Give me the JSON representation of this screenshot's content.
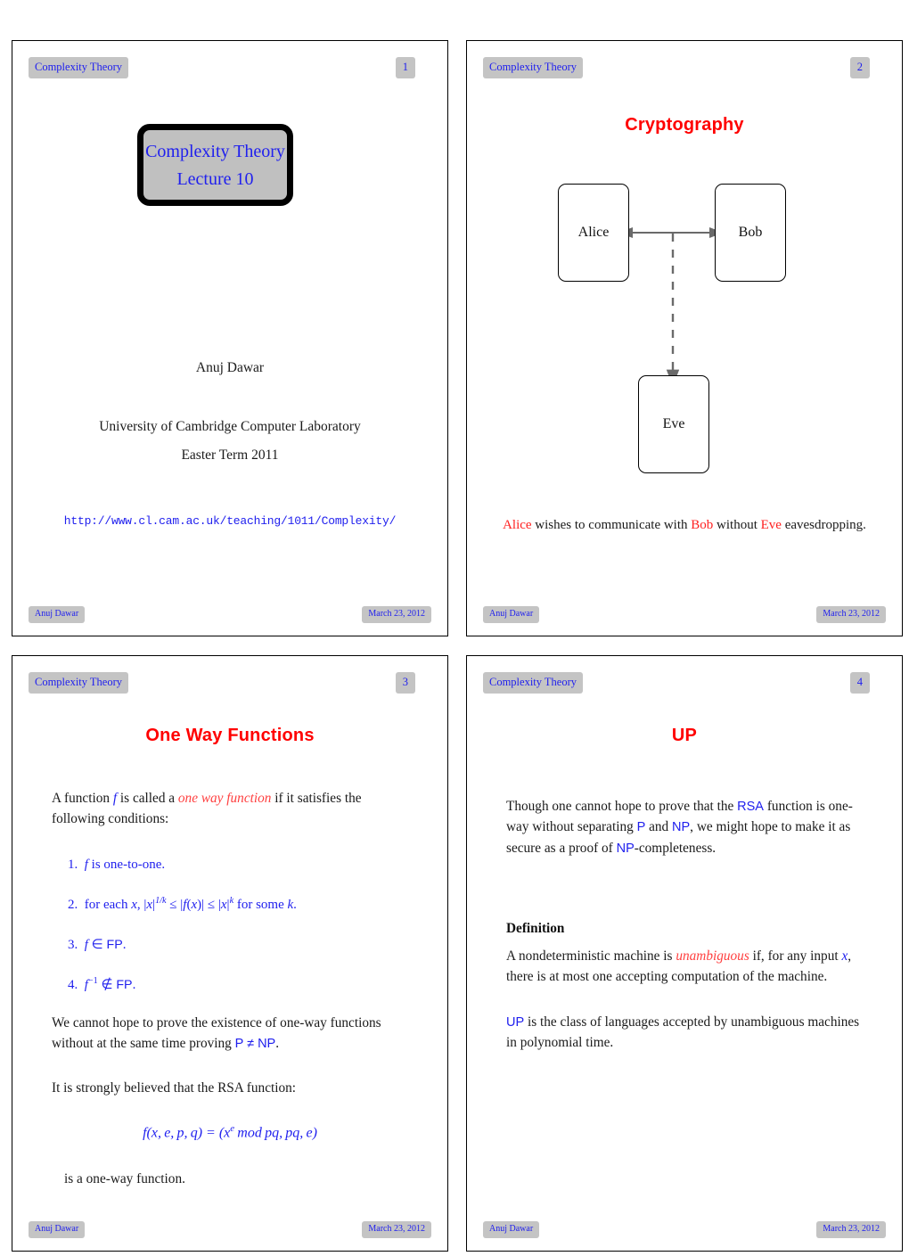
{
  "document": {
    "header_title": "Complexity Theory",
    "footer_author": "Anuj Dawar",
    "footer_date": "March 23, 2012"
  },
  "colors": {
    "heading_red": "#ff0000",
    "link_blue": "#2020ee",
    "badge_gray": "#c4c4c4",
    "title_box_fill": "#c0c0c0",
    "arrow_gray": "#666666"
  },
  "slides": [
    {
      "page": "1",
      "header": "Complexity Theory",
      "title_box": {
        "line1": "Complexity Theory",
        "line2": "Lecture 10"
      },
      "author": "Anuj Dawar",
      "institution": "University of Cambridge Computer Laboratory",
      "term": "Easter Term 2011",
      "url": "http://www.cl.cam.ac.uk/teaching/1011/Complexity/",
      "footer_author": "Anuj Dawar",
      "footer_date": "March 23, 2012"
    },
    {
      "page": "2",
      "header": "Complexity Theory",
      "heading": "Cryptography",
      "nodes": [
        {
          "label": "Alice"
        },
        {
          "label": "Bob"
        },
        {
          "label": "Eve"
        }
      ],
      "caption": {
        "part1": "Alice",
        "part2": " wishes to communicate with ",
        "part3": "Bob",
        "part4": " without ",
        "part5": "Eve",
        "part6": " eavesdropping."
      },
      "footer_author": "Anuj Dawar",
      "footer_date": "March 23, 2012"
    },
    {
      "page": "3",
      "header": "Complexity Theory",
      "heading": "One Way Functions",
      "intro": {
        "a": "A function ",
        "f": "f",
        "b": " is called a ",
        "term": "one way function",
        "c": " if it satisfies the following conditions:"
      },
      "conditions": [
        {
          "num": "1.",
          "text_html": "f is one-to-one."
        },
        {
          "num": "2.",
          "text_html": "for each x, |x|^(1/k) <= |f(x)| <= |x|^k for some k."
        },
        {
          "num": "3.",
          "text_html": "f is in FP."
        },
        {
          "num": "4.",
          "text_html": "f^-1 is not in FP."
        }
      ],
      "para_cannot": {
        "a": "We cannot hope to prove the existence of one-way functions without at the same time proving ",
        "pne": "P ≠ NP",
        "b": "."
      },
      "para_rsa": "It is strongly believed that the RSA function:",
      "rsa_formula": "f(x, e, p, q) = (x^e mod pq, pq, e)",
      "para_closing": "is a one-way function.",
      "footer_author": "Anuj Dawar",
      "footer_date": "March 23, 2012"
    },
    {
      "page": "4",
      "header": "Complexity Theory",
      "heading": "UP",
      "para_intro": {
        "a": "Though one cannot hope to prove that the ",
        "rsa": "RSA",
        "b": " function is one-way without separating ",
        "p": "P",
        "c": " and ",
        "np": "NP",
        "d": ", we might hope to make it as secure as a proof of ",
        "np2": "NP",
        "e": "-completeness."
      },
      "definition_heading": "Definition",
      "definition_body": {
        "a": "A nondeterministic machine is ",
        "term": "unambiguous",
        "b": " if, for any input ",
        "x": "x",
        "c": ", there is at most one accepting computation of the machine."
      },
      "up_para": {
        "up": "UP",
        "text": " is the class of languages accepted by unambiguous machines in polynomial time."
      },
      "footer_author": "Anuj Dawar",
      "footer_date": "March 23, 2012"
    }
  ]
}
